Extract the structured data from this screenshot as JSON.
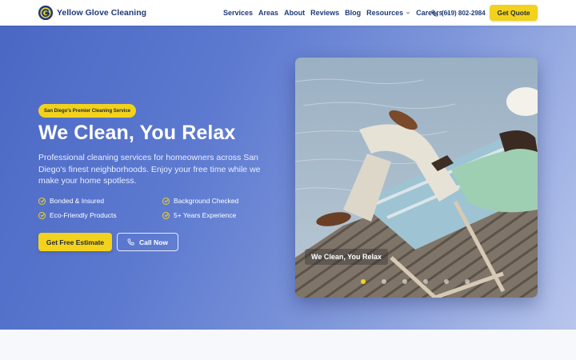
{
  "header": {
    "brand": "Yellow Glove Cleaning",
    "nav": [
      {
        "label": "Services",
        "has_dropdown": false
      },
      {
        "label": "Areas",
        "has_dropdown": false
      },
      {
        "label": "About",
        "has_dropdown": false
      },
      {
        "label": "Reviews",
        "has_dropdown": false
      },
      {
        "label": "Blog",
        "has_dropdown": false
      },
      {
        "label": "Resources",
        "has_dropdown": true
      },
      {
        "label": "Careers",
        "has_dropdown": true
      }
    ],
    "phone": "(619) 802-2984",
    "cta": "Get Quote"
  },
  "hero": {
    "badge": "San Diego's Premier Cleaning Service",
    "title": "We Clean, You Relax",
    "subtitle": "Professional cleaning services for homeowners across San Diego's finest neighborhoods. Enjoy your free time while we make your home spotless.",
    "features": [
      "Bonded & Insured",
      "Background Checked",
      "Eco-Friendly Products",
      "5+ Years Experience"
    ],
    "primary_cta": "Get Free Estimate",
    "secondary_cta": "Call Now",
    "slide_caption": "We Clean, You Relax",
    "slides_total": 6,
    "active_slide": 1
  },
  "colors": {
    "brand_navy": "#1e3a7b",
    "accent_yellow": "#f3d21d",
    "hero_gradient_start": "#4a67c4",
    "hero_gradient_end": "#b8c6ec"
  },
  "icons": [
    "logo-g-icon",
    "phone-icon",
    "chevron-down-icon",
    "check-circle-icon"
  ]
}
